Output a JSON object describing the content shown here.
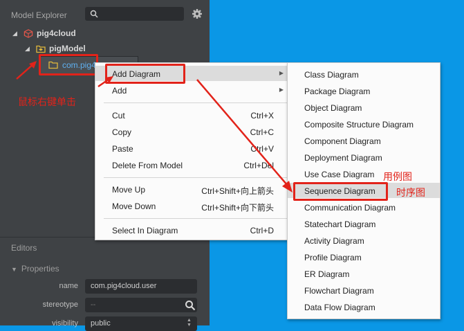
{
  "explorer": {
    "title": "Model Explorer",
    "tree": {
      "root": "pig4cloud",
      "model": "pigModel",
      "package": "com.pig4"
    }
  },
  "annotations": {
    "right_click": "鼠标右键单击",
    "use_case": "用例图",
    "sequence": "时序图",
    "color": "#e2231a"
  },
  "editors": {
    "title": "Editors",
    "properties_title": "Properties",
    "rows": [
      {
        "label": "name",
        "value": "com.pig4cloud.user"
      },
      {
        "label": "stereotype",
        "value": "--"
      },
      {
        "label": "visibility",
        "value": "public"
      }
    ]
  },
  "context_menu": {
    "add_diagram": "Add Diagram",
    "add": "Add",
    "cut": {
      "label": "Cut",
      "shortcut": "Ctrl+X"
    },
    "copy": {
      "label": "Copy",
      "shortcut": "Ctrl+C"
    },
    "paste": {
      "label": "Paste",
      "shortcut": "Ctrl+V"
    },
    "delete": {
      "label": "Delete From Model",
      "shortcut": "Ctrl+Del"
    },
    "move_up": {
      "label": "Move Up",
      "shortcut": "Ctrl+Shift+向上箭头"
    },
    "move_down": {
      "label": "Move Down",
      "shortcut": "Ctrl+Shift+向下箭头"
    },
    "select_in_diagram": {
      "label": "Select In Diagram",
      "shortcut": "Ctrl+D"
    }
  },
  "submenu": {
    "items": [
      "Class Diagram",
      "Package Diagram",
      "Object Diagram",
      "Composite Structure Diagram",
      "Component Diagram",
      "Deployment Diagram",
      "Use Case Diagram",
      "Sequence Diagram",
      "Communication Diagram",
      "Statechart Diagram",
      "Activity Diagram",
      "Profile Diagram",
      "ER Diagram",
      "Flowchart Diagram",
      "Data Flow Diagram"
    ]
  },
  "colors": {
    "background_blue": "#0a97e6",
    "panel_dark": "#3f4245",
    "menu_bg": "#fbfbfb",
    "highlight": "#dcdcdc"
  }
}
